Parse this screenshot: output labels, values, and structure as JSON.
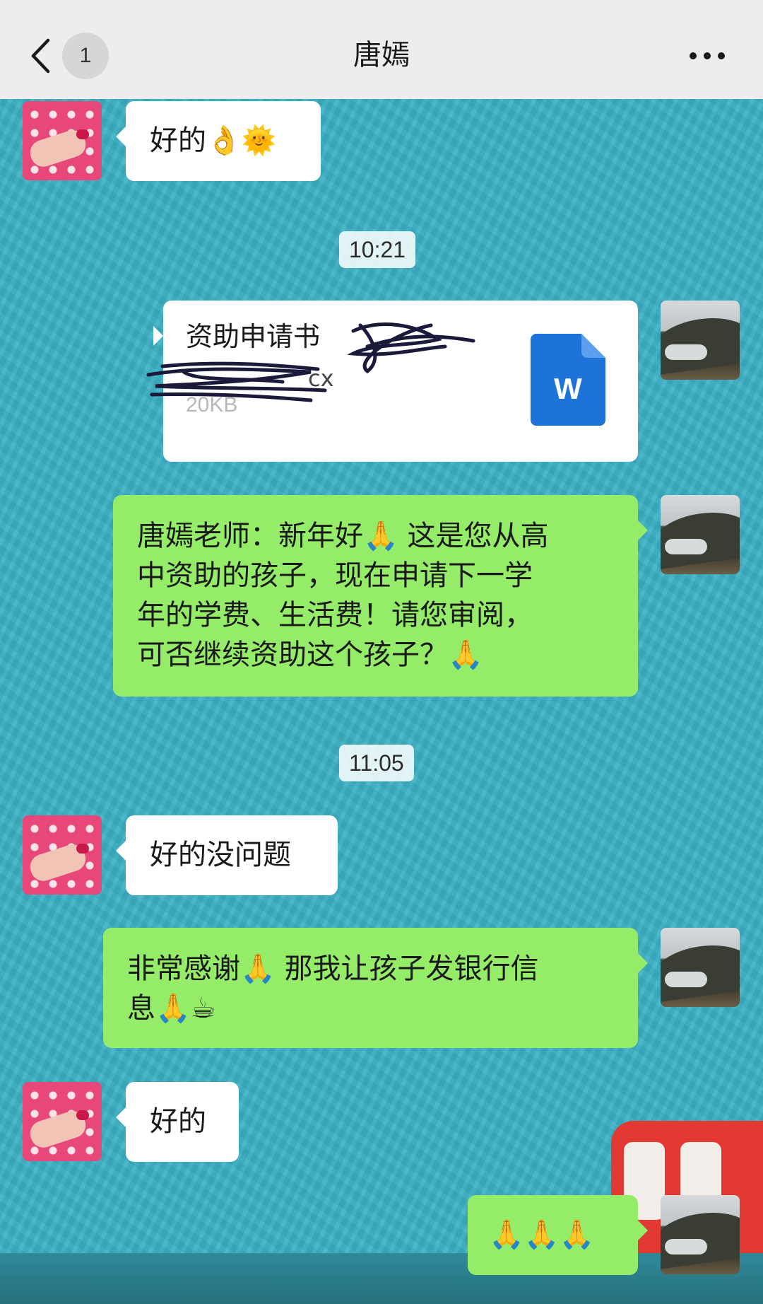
{
  "header": {
    "back_icon": "chevron-left-icon",
    "unread_count": "1",
    "title": "唐嫣",
    "more_icon": "more-dots-icon"
  },
  "messages": {
    "m1": {
      "sender": "contact",
      "text": "好的👌🌞"
    },
    "t1": "10:21",
    "file": {
      "sender": "me",
      "name": "资助申请书",
      "ext_visible": "cx",
      "size": "20KB",
      "icon": "word-doc-icon",
      "icon_letter": "W"
    },
    "m2": {
      "sender": "me",
      "line1": "唐嫣老师：新年好🙏 这是您从高",
      "line2": "中资助的孩子，现在申请下一学",
      "line3": "年的学费、生活费！请您审阅，",
      "line4": "可否继续资助这个孩子？🙏"
    },
    "t2": "11:05",
    "m3": {
      "sender": "contact",
      "text": "好的没问题"
    },
    "m4": {
      "sender": "me",
      "line1": "非常感谢🙏 那我让孩子发银行信",
      "line2": "息🙏☕"
    },
    "m5": {
      "sender": "contact",
      "text": "好的"
    },
    "m6": {
      "sender": "me",
      "text": "🙏🙏🙏"
    }
  },
  "colors": {
    "chat_bg": "#3bb0c4",
    "my_bubble": "#95ec69",
    "their_bubble": "#ffffff",
    "word_blue": "#1e73d8"
  }
}
